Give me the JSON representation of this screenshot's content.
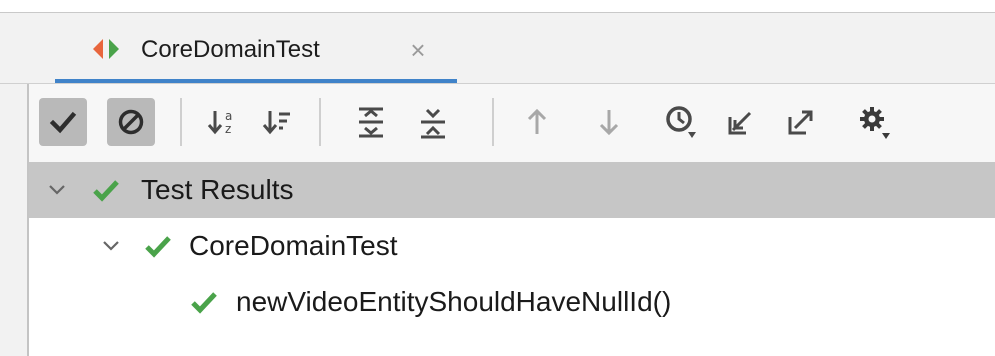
{
  "tab": {
    "label": "CoreDomainTest",
    "close_glyph": "×",
    "icon": "test-run-icon"
  },
  "toolbar": {
    "buttons": [
      {
        "name": "show-passed-button",
        "icon": "check-icon",
        "toggled": true
      },
      {
        "name": "show-ignored-button",
        "icon": "ignored-icon",
        "toggled": true
      },
      {
        "name": "sort-alphabetically-button",
        "icon": "sort-alpha-icon",
        "toggled": false
      },
      {
        "name": "sort-by-duration-button",
        "icon": "sort-duration-icon",
        "toggled": false
      },
      {
        "name": "expand-all-button",
        "icon": "expand-all-icon",
        "toggled": false
      },
      {
        "name": "collapse-all-button",
        "icon": "collapse-all-icon",
        "toggled": false
      },
      {
        "name": "previous-failed-button",
        "icon": "arrow-up-icon",
        "toggled": false
      },
      {
        "name": "next-failed-button",
        "icon": "arrow-down-icon",
        "toggled": false
      },
      {
        "name": "test-history-button",
        "icon": "history-icon",
        "toggled": false
      },
      {
        "name": "import-tests-button",
        "icon": "import-icon",
        "toggled": false
      },
      {
        "name": "export-tests-button",
        "icon": "export-icon",
        "toggled": false
      },
      {
        "name": "settings-button",
        "icon": "gear-icon",
        "toggled": false
      }
    ]
  },
  "tree": {
    "rows": [
      {
        "label": "Test Results",
        "status": "passed",
        "expanded": true,
        "depth": 0,
        "selected": true
      },
      {
        "label": "CoreDomainTest",
        "status": "passed",
        "expanded": true,
        "depth": 1,
        "selected": false
      },
      {
        "label": "newVideoEntityShouldHaveNullId()",
        "status": "passed",
        "expanded": null,
        "depth": 2,
        "selected": false
      }
    ]
  },
  "colors": {
    "accent": "#4083c9",
    "pass_green": "#4aa34a",
    "icon_grey": "#5c5c5c",
    "icon_disabled": "#a8a8a8",
    "toggle_bg": "#b9b9b9",
    "selection_bg": "#c6c6c6",
    "tab_icon_red": "#e8663d",
    "tab_icon_green": "#4aa34a"
  }
}
